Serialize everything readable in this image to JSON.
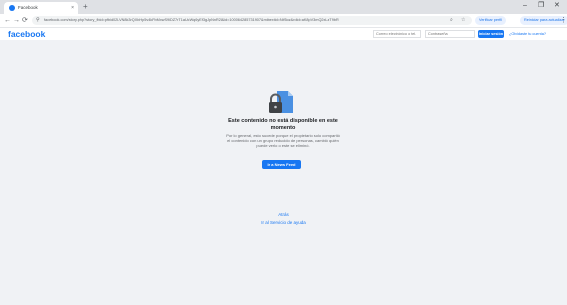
{
  "browser": {
    "tab_title": "Facebook",
    "tab_close": "×",
    "new_tab": "+",
    "window_controls": [
      "–",
      "❐",
      "✕"
    ],
    "nav": {
      "back": "←",
      "forward": "→",
      "reload": "⟳"
    },
    "url": "facebook.com/story.php?story_fbid=pfbid02LVN8k3rQXbHp5v4kFbMxwS9iDZ7rT1aUcWq6yEf3gJpNnR2l&id=100064285731907&mibextid=Nif5oz&rdid=aK8pV3mQ2xLzT9bR",
    "zoom_icon": "zoom-icon",
    "bookmark_icon": "star-icon",
    "profile_chip": "Verificar perfil",
    "update_chip": "Reiniciar para actualizar",
    "menu_icon": "⋮"
  },
  "fb": {
    "logo": "facebook",
    "email_placeholder": "Correo electrónico o tel.",
    "password_placeholder": "Contraseña",
    "login_button": "Iniciar sesión",
    "forgot_link": "¿Olvidaste tu cuenta?"
  },
  "error": {
    "heading": "Este contenido no está disponible en este momento",
    "description": "Por lo general, esto sucede porque el propietario solo compartió el contenido con un grupo reducido de personas, cambió quién puede verlo o este se eliminó.",
    "primary_button": "Ir a News Feed",
    "back_link": "Atrás",
    "help_link": "Ir al Servicio de ayuda"
  },
  "colors": {
    "brand": "#1877f2",
    "page_bg": "#f0f2f5",
    "chrome_bg": "#dfe1e5"
  }
}
